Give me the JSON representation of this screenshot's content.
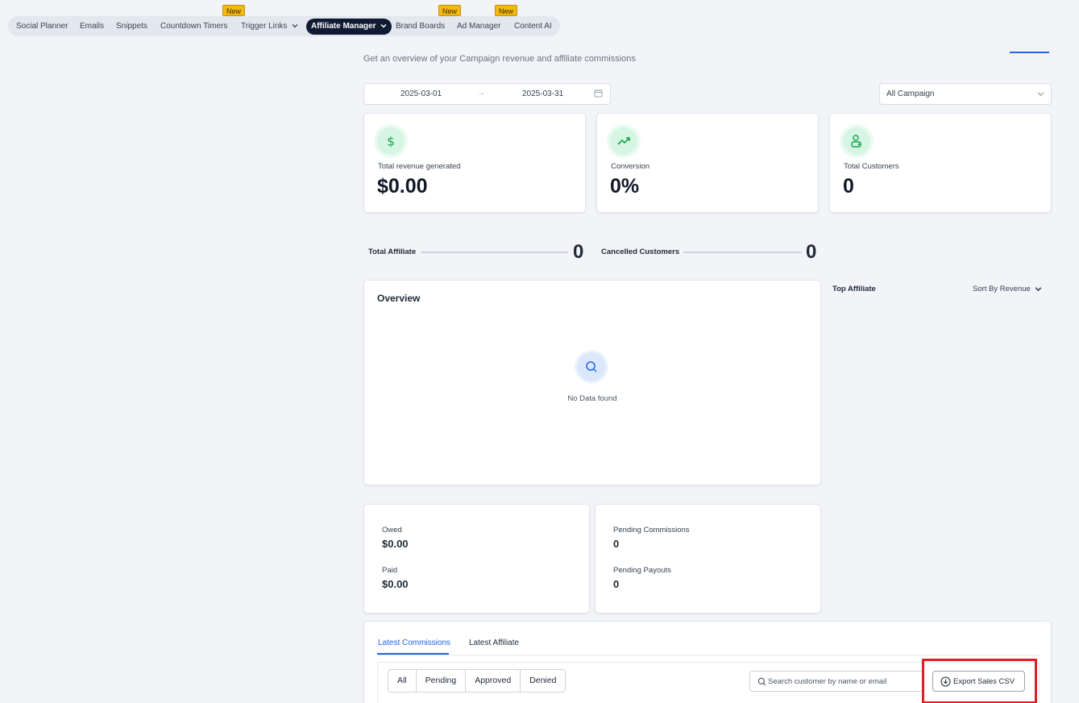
{
  "nav": {
    "items": [
      {
        "label": "Social Planner"
      },
      {
        "label": "Emails"
      },
      {
        "label": "Snippets"
      },
      {
        "label": "Countdown Timers",
        "badge": "New"
      },
      {
        "label": "Trigger Links"
      },
      {
        "label": "Affiliate Manager",
        "active": true
      },
      {
        "label": "Brand Boards",
        "badge": "New"
      },
      {
        "label": "Ad Manager",
        "badge": "New"
      },
      {
        "label": "Content AI"
      }
    ],
    "badge_label": "New"
  },
  "header": {
    "subtitle": "Get an overview of your Campaign revenue and affiliate commissions"
  },
  "filters": {
    "start_date": "2025-03-01",
    "end_date": "2025-03-31",
    "campaign": "All Campaign"
  },
  "stats": [
    {
      "label": "Total revenue generated",
      "value": "$0.00",
      "icon": "dollar-icon"
    },
    {
      "label": "Conversion",
      "value": "0%",
      "icon": "trending-up-icon"
    },
    {
      "label": "Total Customers",
      "value": "0",
      "icon": "customers-icon"
    }
  ],
  "line_stats": {
    "total_affiliate": {
      "label": "Total Affiliate",
      "value": "0"
    },
    "cancelled_customers": {
      "label": "Cancelled Customers",
      "value": "0"
    }
  },
  "overview": {
    "title": "Overview",
    "empty_text": "No Data found"
  },
  "top_affiliate": {
    "title": "Top Affiliate",
    "sort_label": "Sort By Revenue"
  },
  "payouts": {
    "owed_label": "Owed",
    "owed_value": "$0.00",
    "paid_label": "Paid",
    "paid_value": "$0.00",
    "pending_commissions_label": "Pending Commissions",
    "pending_commissions_value": "0",
    "pending_payouts_label": "Pending Payouts",
    "pending_payouts_value": "0"
  },
  "commissions": {
    "tabs": [
      "Latest Commissions",
      "Latest Affiliate"
    ],
    "active_tab": "Latest Commissions",
    "status_filters": [
      "All",
      "Pending",
      "Approved",
      "Denied"
    ],
    "search_placeholder": "Search customer by name or email",
    "export_label": "Export Sales CSV"
  },
  "colors": {
    "accent": "#2563eb",
    "nav_active": "#101a33",
    "badge": "#f5b913",
    "stat_icon_bg": "#d7f5e3",
    "highlight": "#e11d26"
  }
}
